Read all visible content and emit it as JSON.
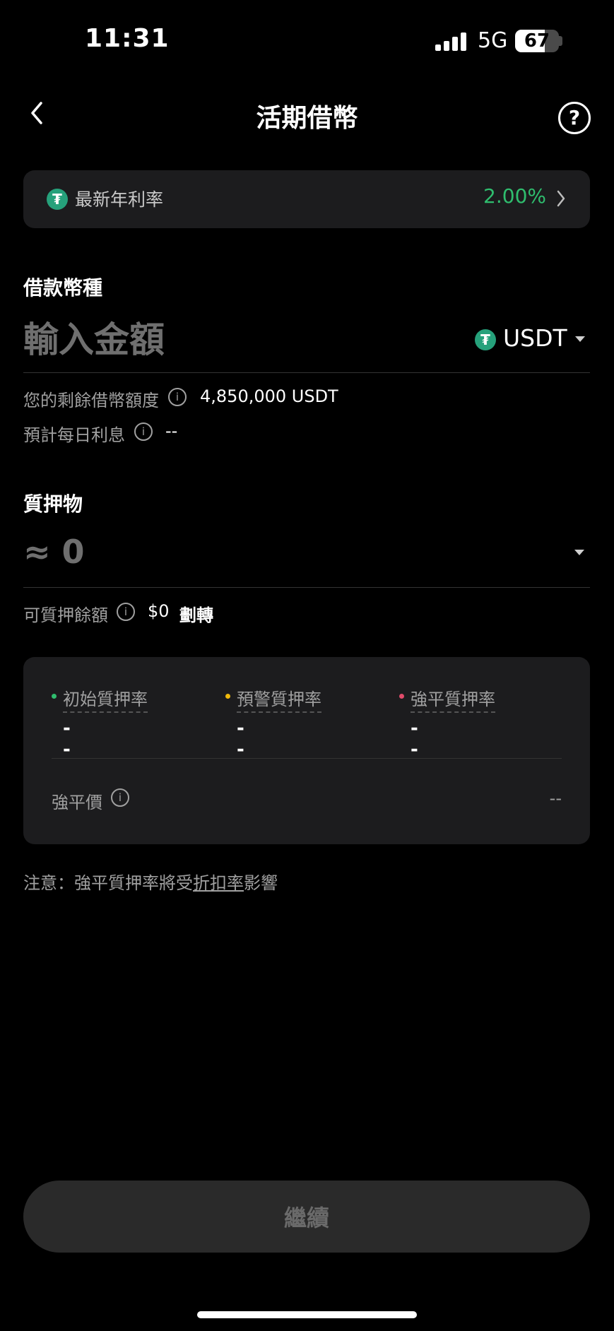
{
  "status_bar": {
    "time": "11:31",
    "network": "5G",
    "battery": "67",
    "battery_percent": 67
  },
  "header": {
    "title": "活期借幣",
    "back_icon": "chevron-left-icon",
    "help_icon": "question-circle-icon"
  },
  "rate_banner": {
    "label": "最新年利率",
    "value": "2.00%"
  },
  "borrow": {
    "section_title": "借款幣種",
    "amount_placeholder": "輸入金額",
    "coin": "USDT",
    "remaining_label": "您的剩餘借幣額度",
    "remaining_value": "4,850,000 USDT",
    "daily_interest_label": "預計每日利息",
    "daily_interest_value": "--"
  },
  "collateral": {
    "section_title": "質押物",
    "value": "≈ 0",
    "available_label": "可質押餘額",
    "available_value": "$0",
    "transfer_label": "劃轉"
  },
  "ratios": {
    "items": [
      {
        "label": "初始質押率",
        "value": "--",
        "color": "#2fbd6e"
      },
      {
        "label": "預警質押率",
        "value": "--",
        "color": "#f0b90b"
      },
      {
        "label": "強平質押率",
        "value": "--",
        "color": "#e04b6a"
      }
    ],
    "liquidation_label": "強平價",
    "liquidation_value": "--"
  },
  "note": {
    "prefix": "注意：強平質押率將受",
    "link": "折扣率",
    "suffix": "影響"
  },
  "continue_label": "繼續",
  "colors": {
    "accent_green": "#2fbd6e",
    "tether": "#26a17b",
    "card_bg": "#1c1c1e"
  }
}
